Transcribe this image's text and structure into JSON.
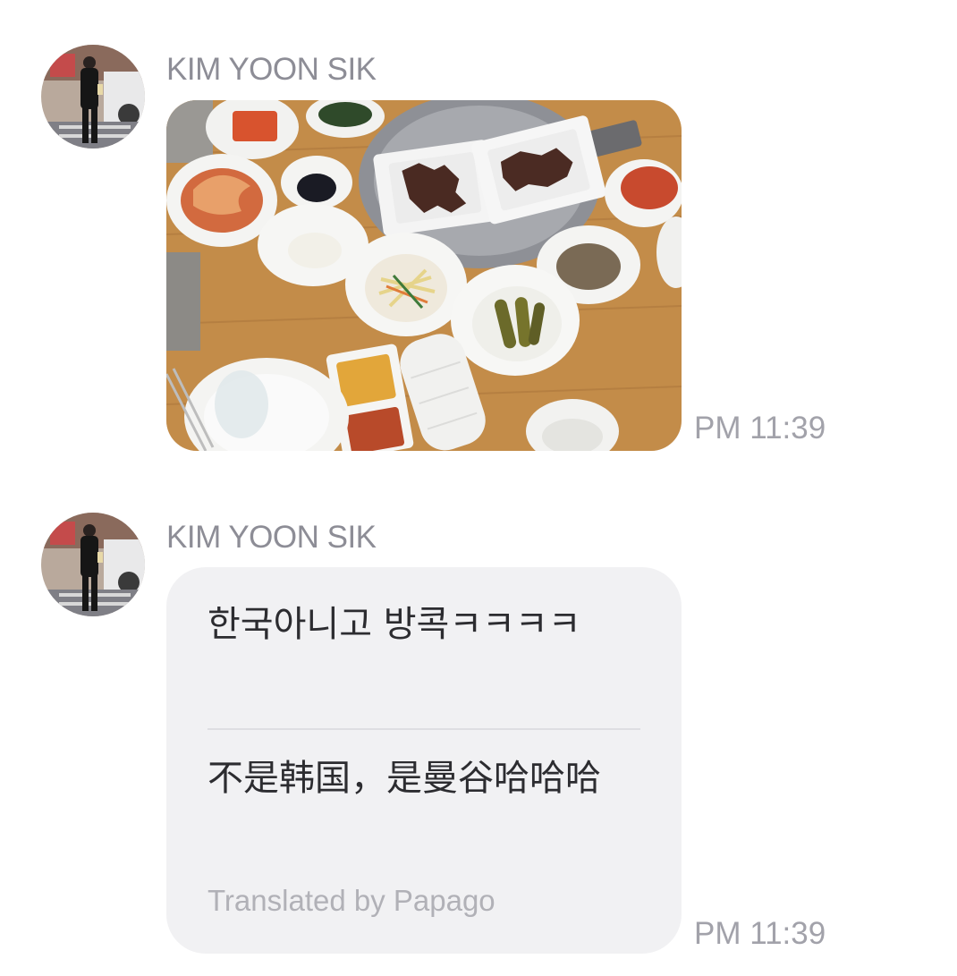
{
  "messages": [
    {
      "sender": "KIM YOON SIK",
      "type": "image",
      "image_alt": "photo",
      "time": "PM 11:39"
    },
    {
      "sender": "KIM YOON SIK",
      "type": "text",
      "original_text": "한국아니고 방콕ㅋㅋㅋㅋ",
      "translated_text": "不是韩国，是曼谷哈哈哈",
      "translation_credit": "Translated by Papago",
      "time": "PM 11:39"
    }
  ],
  "colors": {
    "sender_name": "#8d8d96",
    "timestamp": "#a2a2aa",
    "bubble_background": "#f1f1f3",
    "message_text": "#2c2c30",
    "credit_text": "#b1b1b7"
  },
  "icons": [
    "sender-avatar",
    "shared-food-photo"
  ]
}
